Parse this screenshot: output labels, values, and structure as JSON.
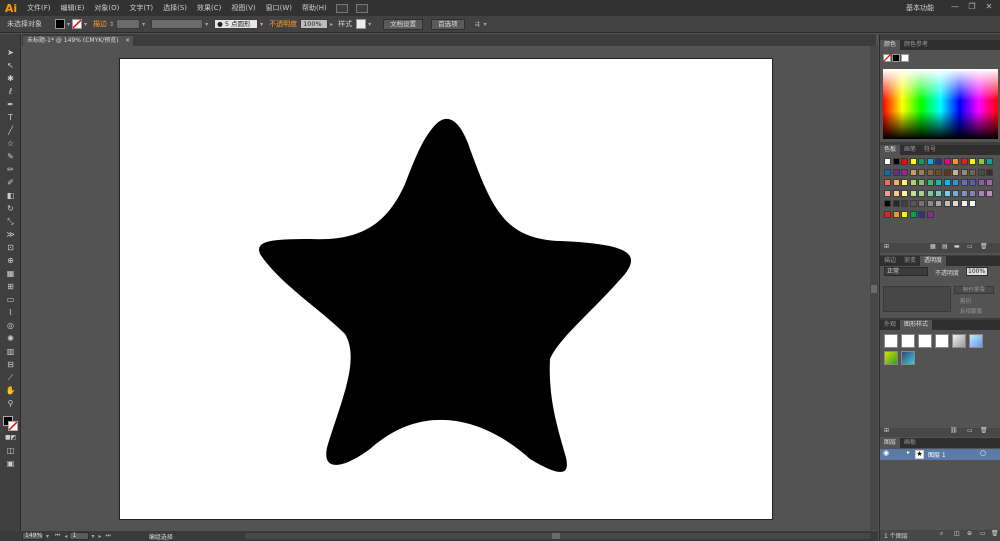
{
  "app": {
    "logo": "Ai",
    "menus": [
      "文件(F)",
      "编辑(E)",
      "对象(O)",
      "文字(T)",
      "选择(S)",
      "效果(C)",
      "视图(V)",
      "窗口(W)",
      "帮助(H)"
    ],
    "workspace": "基本功能",
    "window_controls": [
      "—",
      "❐",
      "✕"
    ]
  },
  "control_bar": {
    "selection_status": "未选择对象",
    "stroke_label": "描边",
    "brush_label": "5 点圆形",
    "opacity_label": "不透明度",
    "opacity_value": "100%",
    "style_label": "样式",
    "doc_setup_button": "文档设置",
    "preferences_button": "首选项"
  },
  "document": {
    "tab_title": "未标题-1* @ 149% (CMYK/预览)",
    "tab_close": "×"
  },
  "artwork": {
    "shape": "rounded-star",
    "fill_color": "#000000",
    "artboard_color": "#ffffff"
  },
  "status_bar": {
    "zoom": "149%",
    "artboard_number": "1",
    "current_tool": "编组选择"
  },
  "panels": {
    "color": {
      "tabs": [
        "颜色",
        "颜色参考"
      ]
    },
    "swatches": {
      "tabs": [
        "色板",
        "画笔",
        "符号"
      ]
    },
    "stroke_transparency": {
      "tabs": [
        "描边",
        "渐变",
        "透明度"
      ],
      "blend_mode": "正常",
      "opacity_label": "不透明度",
      "opacity_value": "100%",
      "make_mask_button": "制作蒙版",
      "clip_label": "剪切",
      "invert_mask_label": "反相蒙版"
    },
    "graphic_styles": {
      "tabs": [
        "外观",
        "图形样式"
      ]
    },
    "layers": {
      "tabs": [
        "图层",
        "画板"
      ],
      "layer_name": "图层 1",
      "footer": "1 个图层"
    }
  },
  "colors": {
    "menubar_bg": "#323232",
    "panel_bg": "#535353",
    "accent_orange": "#ff9c2a",
    "layer_highlight": "#5a7aa8"
  }
}
